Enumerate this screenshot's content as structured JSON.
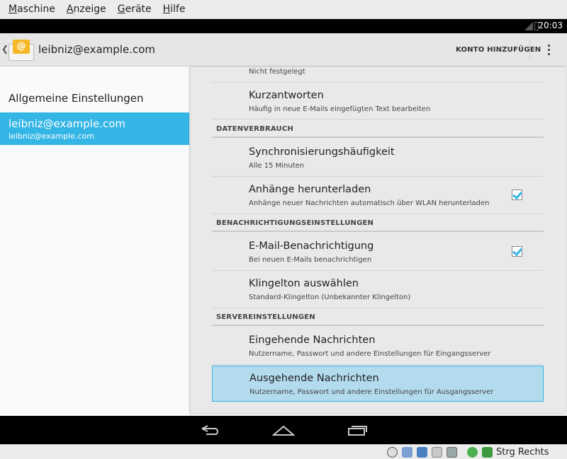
{
  "host_menu": [
    {
      "key": "M",
      "rest": "aschine"
    },
    {
      "key": "A",
      "rest": "nzeige"
    },
    {
      "key": "G",
      "rest": "eräte"
    },
    {
      "key": "H",
      "rest": "ilfe"
    }
  ],
  "statusbar": {
    "time": "20:03"
  },
  "actionbar": {
    "account": "leibniz@example.com",
    "add_account": "KONTO HINZUFÜGEN",
    "app_icon_glyph": "@"
  },
  "left": {
    "general": "Allgemeine Einstellungen",
    "account_title": "leibniz@example.com",
    "account_subtitle": "leibniz@example.com"
  },
  "right": {
    "partial_summary": "Nicht festgelegt",
    "quick_replies": {
      "title": "Kurzantworten",
      "summary": "Häufig in neue E-Mails eingefügten Text bearbeiten"
    },
    "cat_data": "DATENVERBRAUCH",
    "sync": {
      "title": "Synchronisierungshäufigkeit",
      "summary": "Alle 15 Minuten"
    },
    "attachments": {
      "title": "Anhänge herunterladen",
      "summary": "Anhänge neuer Nachrichten automatisch über WLAN herunterladen",
      "checked": true
    },
    "cat_notify": "BENACHRICHTIGUNGSEINSTELLUNGEN",
    "email_notify": {
      "title": "E-Mail-Benachrichtigung",
      "summary": "Bei neuen E-Mails benachrichtigen",
      "checked": true
    },
    "ringtone": {
      "title": "Klingelton auswählen",
      "summary": "Standard-Klingelton (Unbekannter Klingelton)"
    },
    "cat_server": "SERVEREINSTELLUNGEN",
    "incoming": {
      "title": "Eingehende Nachrichten",
      "summary": "Nutzername, Passwort und andere Einstellungen für Eingangsserver"
    },
    "outgoing": {
      "title": "Ausgehende Nachrichten",
      "summary": "Nutzername, Passwort und andere Einstellungen für Ausgangsserver"
    }
  },
  "host_status": {
    "label": "Strg Rechts"
  },
  "colors": {
    "accent": "#33b5e5",
    "selected_bg": "#b3dbee"
  }
}
